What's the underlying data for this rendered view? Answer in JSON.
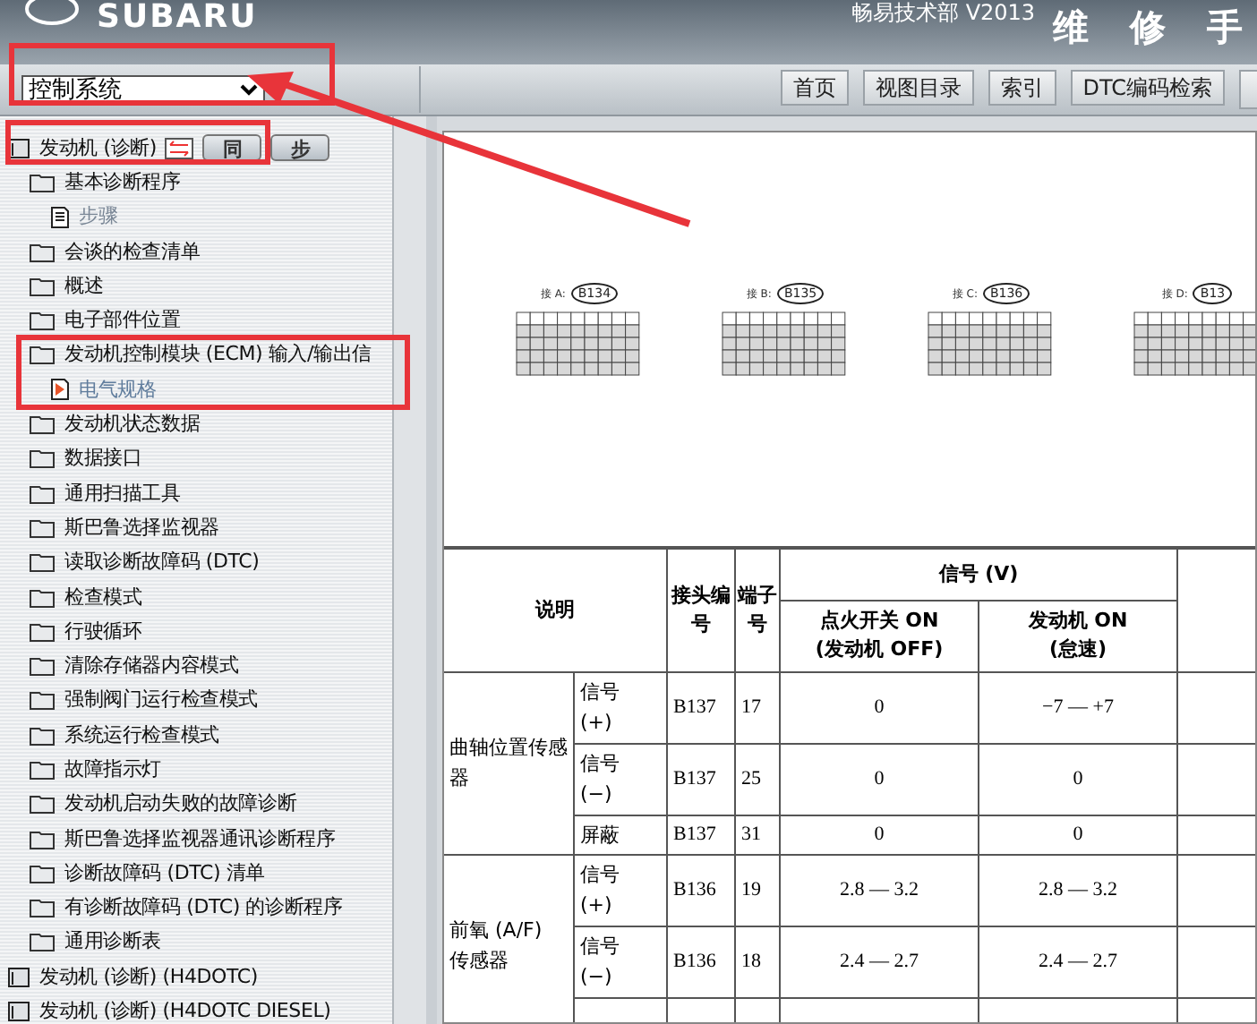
{
  "header": {
    "brand": "SUBARU",
    "vendor": "畅易技术部 V2013",
    "title": "维 修 手"
  },
  "toolbar": {
    "system_select": {
      "value": "控制系统"
    },
    "buttons": [
      "首页",
      "视图目录",
      "索引",
      "DTC编码检索"
    ]
  },
  "sync_buttons": [
    "同",
    "步"
  ],
  "tree": {
    "label": "发动机 (诊断)",
    "kind": "root",
    "selected": false,
    "children": [
      {
        "label": "基本诊断程序",
        "kind": "folder",
        "selected": false,
        "children": [
          {
            "label": "步骤",
            "kind": "page",
            "selected": false
          }
        ]
      },
      {
        "label": "会谈的检查清单",
        "kind": "folder",
        "selected": false
      },
      {
        "label": "概述",
        "kind": "folder",
        "selected": false
      },
      {
        "label": "电子部件位置",
        "kind": "folder",
        "selected": false
      },
      {
        "label": "发动机控制模块 (ECM) 输入/输出信",
        "kind": "folder",
        "selected": false,
        "children": [
          {
            "label": "电气规格",
            "kind": "page",
            "selected": true
          }
        ]
      },
      {
        "label": "发动机状态数据",
        "kind": "folder",
        "selected": false
      },
      {
        "label": "数据接口",
        "kind": "folder",
        "selected": false
      },
      {
        "label": "通用扫描工具",
        "kind": "folder",
        "selected": false
      },
      {
        "label": "斯巴鲁选择监视器",
        "kind": "folder",
        "selected": false
      },
      {
        "label": "读取诊断故障码 (DTC)",
        "kind": "folder",
        "selected": false
      },
      {
        "label": "检查模式",
        "kind": "folder",
        "selected": false
      },
      {
        "label": "行驶循环",
        "kind": "folder",
        "selected": false
      },
      {
        "label": "清除存储器内容模式",
        "kind": "folder",
        "selected": false
      },
      {
        "label": "强制阀门运行检查模式",
        "kind": "folder",
        "selected": false
      },
      {
        "label": "系统运行检查模式",
        "kind": "folder",
        "selected": false
      },
      {
        "label": "故障指示灯",
        "kind": "folder",
        "selected": false
      },
      {
        "label": "发动机启动失败的故障诊断",
        "kind": "folder",
        "selected": false
      },
      {
        "label": "斯巴鲁选择监视器通讯诊断程序",
        "kind": "folder",
        "selected": false
      },
      {
        "label": "诊断故障码 (DTC) 清单",
        "kind": "folder",
        "selected": false
      },
      {
        "label": "有诊断故障码 (DTC) 的诊断程序",
        "kind": "folder",
        "selected": false
      },
      {
        "label": "通用诊断表",
        "kind": "folder",
        "selected": false
      }
    ]
  },
  "tree_siblings": [
    {
      "label": "发动机 (诊断) (H4DOTC)",
      "kind": "root",
      "selected": false
    },
    {
      "label": "发动机 (诊断) (H4DOTC DIESEL)",
      "kind": "root",
      "selected": false
    }
  ],
  "connectors": [
    {
      "label": "接 A:",
      "code": "B134"
    },
    {
      "label": "接 B:",
      "code": "B135"
    },
    {
      "label": "接 C:",
      "code": "B136"
    },
    {
      "label": "接 D:",
      "code": "B13"
    }
  ],
  "table": {
    "headers": {
      "description": "说明",
      "connector": "接头编号",
      "terminal": "端子号",
      "signal": "信号 (V)",
      "ign_on": "点火开关 ON\n(发动机 OFF)",
      "engine_on": "发动机 ON\n(怠速)"
    },
    "groups": [
      {
        "name": "曲轴位置传感器",
        "rows": [
          {
            "item": "信号\n(+)",
            "connector": "B137",
            "terminal": "17",
            "ign_on": "0",
            "engine_on": "−7 — +7"
          },
          {
            "item": "信号\n(−)",
            "connector": "B137",
            "terminal": "25",
            "ign_on": "0",
            "engine_on": "0"
          },
          {
            "item": "屏蔽",
            "connector": "B137",
            "terminal": "31",
            "ign_on": "0",
            "engine_on": "0"
          }
        ]
      },
      {
        "name": "前氧 (A/F)\n传感器",
        "rows": [
          {
            "item": "信号\n(+)",
            "connector": "B136",
            "terminal": "19",
            "ign_on": "2.8 — 3.2",
            "engine_on": "2.8 — 3.2"
          },
          {
            "item": "信号\n(−)",
            "connector": "B136",
            "terminal": "18",
            "ign_on": "2.4 — 2.7",
            "engine_on": "2.4 — 2.7"
          }
        ]
      }
    ]
  }
}
